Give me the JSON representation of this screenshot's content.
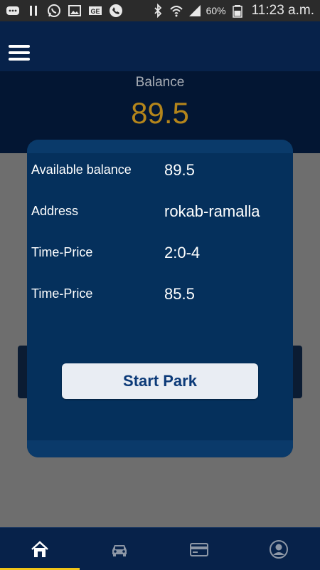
{
  "status_bar": {
    "battery_percent": "60%",
    "time": "11:23 a.m.",
    "icons": [
      "chat-bubble-icon",
      "pause-icon",
      "whatsapp-icon",
      "image-icon",
      "ge-icon",
      "phone-icon",
      "bluetooth-icon",
      "wifi-icon",
      "signal-icon",
      "battery-icon"
    ]
  },
  "app_bar": {
    "menu_icon": "hamburger-menu-icon"
  },
  "balance_header": {
    "label": "Balance",
    "value": "89.5"
  },
  "dialog": {
    "rows": [
      {
        "label": "Available balance",
        "value": "89.5"
      },
      {
        "label": "Address",
        "value": "rokab-ramalla"
      },
      {
        "label": "Time-Price",
        "value": "2:0-4"
      },
      {
        "label": "Time-Price",
        "value": "85.5"
      }
    ],
    "start_button_label": "Start Park"
  },
  "bottom_nav": {
    "items": [
      {
        "icon": "home-icon",
        "active": true
      },
      {
        "icon": "car-icon",
        "active": false
      },
      {
        "icon": "credit-card-icon",
        "active": false
      },
      {
        "icon": "profile-icon",
        "active": false
      }
    ]
  },
  "colors": {
    "app_bar": "#07224a",
    "header_bg": "#031633",
    "balance_value": "#b4851b",
    "dialog_bg": "#05305c",
    "button_bg": "#e9edf3",
    "button_text": "#0c3a78",
    "nav_indicator": "#f0c419"
  }
}
